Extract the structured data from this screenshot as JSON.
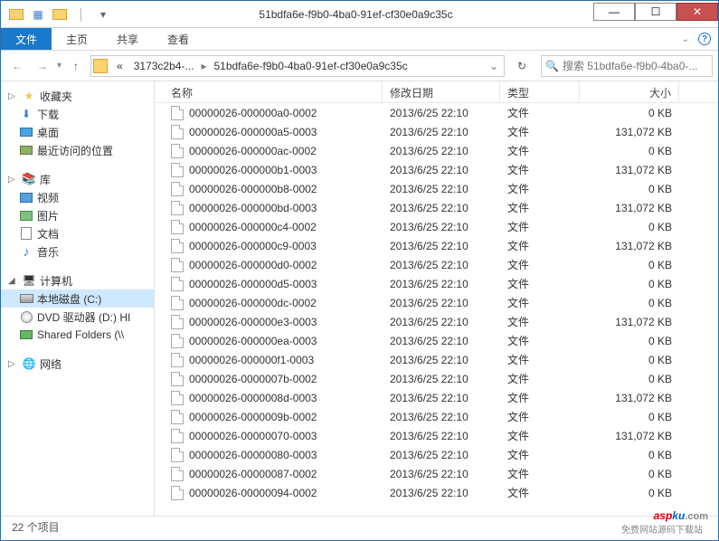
{
  "window": {
    "title": "51bdfa6e-f9b0-4ba0-91ef-cf30e0a9c35c"
  },
  "ribbon": {
    "file": "文件",
    "home": "主页",
    "share": "共享",
    "view": "查看"
  },
  "breadcrumb": {
    "b1": "3173c2b4-...",
    "b2": "51bdfa6e-f9b0-4ba0-91ef-cf30e0a9c35c"
  },
  "search": {
    "placeholder": "搜索 51bdfa6e-f9b0-4ba0-..."
  },
  "headers": {
    "name": "名称",
    "date": "修改日期",
    "type": "类型",
    "size": "大小"
  },
  "sidebar": {
    "fav": "收藏夹",
    "dl": "下载",
    "desk": "桌面",
    "recent": "最近访问的位置",
    "lib": "库",
    "vid": "视频",
    "pic": "图片",
    "doc": "文档",
    "mus": "音乐",
    "comp": "计算机",
    "cdrive": "本地磁盘 (C:)",
    "dvd": "DVD 驱动器 (D:) HI",
    "share": "Shared Folders (\\\\",
    "net": "网络"
  },
  "files": [
    {
      "name": "00000026-000000a0-0002",
      "date": "2013/6/25 22:10",
      "type": "文件",
      "size": "0 KB"
    },
    {
      "name": "00000026-000000a5-0003",
      "date": "2013/6/25 22:10",
      "type": "文件",
      "size": "131,072 KB"
    },
    {
      "name": "00000026-000000ac-0002",
      "date": "2013/6/25 22:10",
      "type": "文件",
      "size": "0 KB"
    },
    {
      "name": "00000026-000000b1-0003",
      "date": "2013/6/25 22:10",
      "type": "文件",
      "size": "131,072 KB"
    },
    {
      "name": "00000026-000000b8-0002",
      "date": "2013/6/25 22:10",
      "type": "文件",
      "size": "0 KB"
    },
    {
      "name": "00000026-000000bd-0003",
      "date": "2013/6/25 22:10",
      "type": "文件",
      "size": "131,072 KB"
    },
    {
      "name": "00000026-000000c4-0002",
      "date": "2013/6/25 22:10",
      "type": "文件",
      "size": "0 KB"
    },
    {
      "name": "00000026-000000c9-0003",
      "date": "2013/6/25 22:10",
      "type": "文件",
      "size": "131,072 KB"
    },
    {
      "name": "00000026-000000d0-0002",
      "date": "2013/6/25 22:10",
      "type": "文件",
      "size": "0 KB"
    },
    {
      "name": "00000026-000000d5-0003",
      "date": "2013/6/25 22:10",
      "type": "文件",
      "size": "0 KB"
    },
    {
      "name": "00000026-000000dc-0002",
      "date": "2013/6/25 22:10",
      "type": "文件",
      "size": "0 KB"
    },
    {
      "name": "00000026-000000e3-0003",
      "date": "2013/6/25 22:10",
      "type": "文件",
      "size": "131,072 KB"
    },
    {
      "name": "00000026-000000ea-0003",
      "date": "2013/6/25 22:10",
      "type": "文件",
      "size": "0 KB"
    },
    {
      "name": "00000026-000000f1-0003",
      "date": "2013/6/25 22:10",
      "type": "文件",
      "size": "0 KB"
    },
    {
      "name": "00000026-0000007b-0002",
      "date": "2013/6/25 22:10",
      "type": "文件",
      "size": "0 KB"
    },
    {
      "name": "00000026-0000008d-0003",
      "date": "2013/6/25 22:10",
      "type": "文件",
      "size": "131,072 KB"
    },
    {
      "name": "00000026-0000009b-0002",
      "date": "2013/6/25 22:10",
      "type": "文件",
      "size": "0 KB"
    },
    {
      "name": "00000026-00000070-0003",
      "date": "2013/6/25 22:10",
      "type": "文件",
      "size": "131,072 KB"
    },
    {
      "name": "00000026-00000080-0003",
      "date": "2013/6/25 22:10",
      "type": "文件",
      "size": "0 KB"
    },
    {
      "name": "00000026-00000087-0002",
      "date": "2013/6/25 22:10",
      "type": "文件",
      "size": "0 KB"
    },
    {
      "name": "00000026-00000094-0002",
      "date": "2013/6/25 22:10",
      "type": "文件",
      "size": "0 KB"
    }
  ],
  "status": {
    "count": "22 个项目"
  }
}
